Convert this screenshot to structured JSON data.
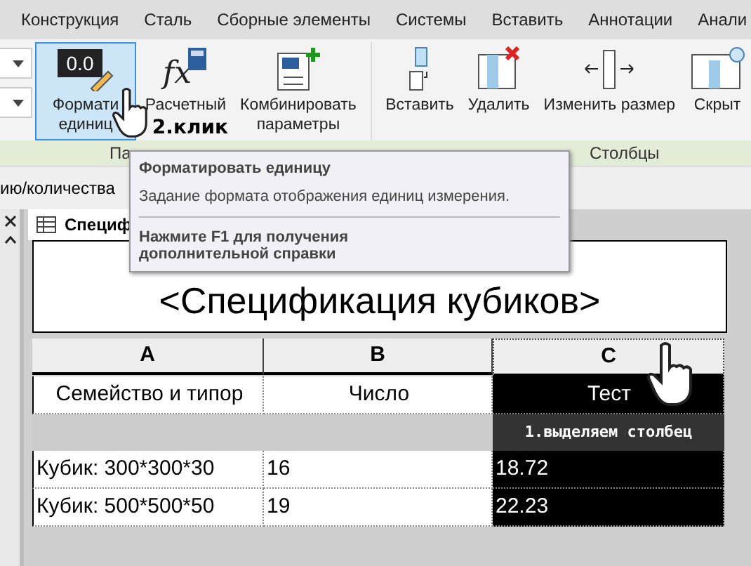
{
  "tabs": [
    {
      "label": "Конструкция"
    },
    {
      "label": "Сталь"
    },
    {
      "label": "Сборные элементы"
    },
    {
      "label": "Системы"
    },
    {
      "label": "Вставить"
    },
    {
      "label": "Аннотации"
    },
    {
      "label": "Анали"
    }
  ],
  "ribbon": {
    "buttons": [
      {
        "kind": "format",
        "icon_text": "0.0",
        "lines": [
          "Формати",
          "единиц"
        ],
        "selected": true
      },
      {
        "kind": "calc",
        "icon_text": "fx",
        "lines": [
          "Расчетный"
        ],
        "selected": false
      },
      {
        "kind": "combine",
        "lines": [
          "Комбинировать",
          "параметры"
        ],
        "selected": false
      },
      {
        "kind": "insert",
        "lines": [
          "Вставить"
        ],
        "selected": false
      },
      {
        "kind": "delete",
        "lines": [
          "Удалить"
        ],
        "selected": false
      },
      {
        "kind": "resize",
        "lines": [
          "Изменить размер"
        ],
        "selected": false
      },
      {
        "kind": "hide",
        "lines": [
          "Скрыт"
        ],
        "selected": false
      }
    ],
    "panels": [
      "Па",
      "Столбцы"
    ],
    "click_note": "2.клик"
  },
  "options_bar": "ию/количества",
  "view_tab": "Специф",
  "tooltip": {
    "title": "Форматировать единицу",
    "description": "Задание формата отображения единиц измерения.",
    "help": "Нажмите F1 для получения дополнительной справки"
  },
  "schedule": {
    "title": "<Спецификация кубиков>",
    "columns": [
      {
        "letter": "A",
        "heading": "Семейство и типор",
        "selected": false
      },
      {
        "letter": "B",
        "heading": "Число",
        "selected": false
      },
      {
        "letter": "C",
        "heading": "Тест",
        "selected": true
      }
    ],
    "select_note": "1.выделяем столбец",
    "rows": [
      [
        "Кубик: 300*300*30",
        "16",
        "18.72"
      ],
      [
        "Кубик: 500*500*50",
        "19",
        "22.23"
      ]
    ]
  }
}
